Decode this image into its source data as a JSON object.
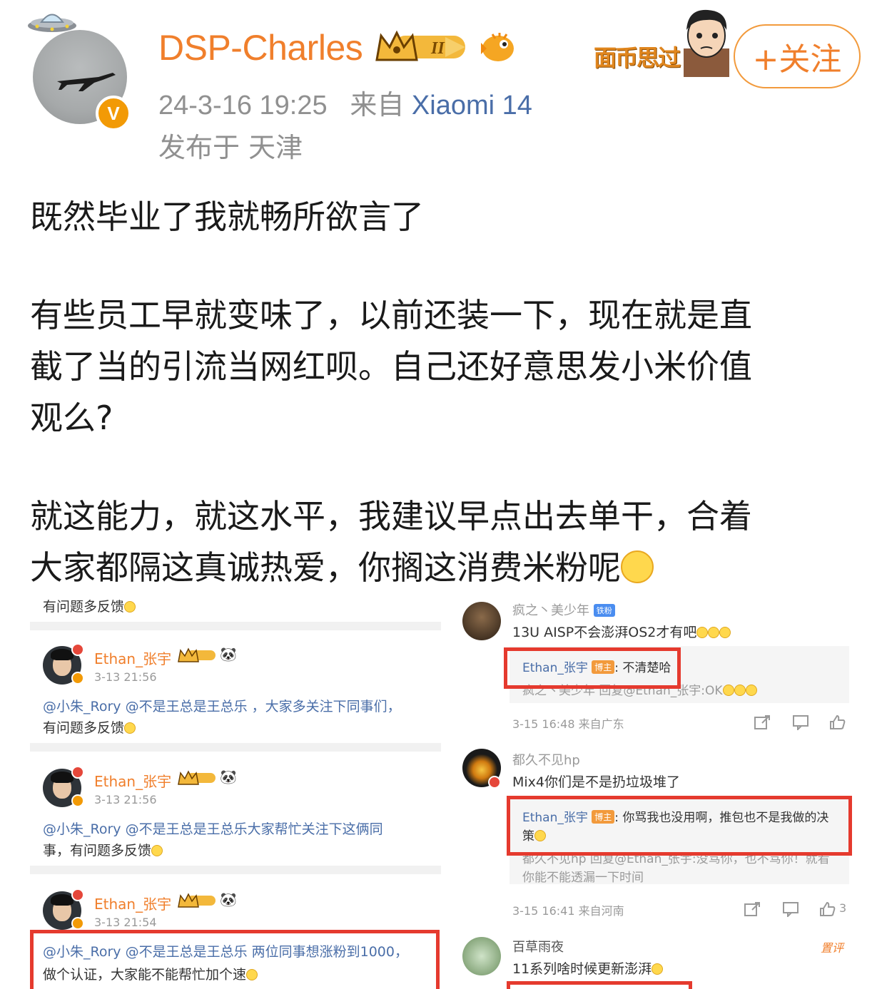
{
  "header": {
    "username": "DSP-Charles",
    "timestamp": "24-3-16 19:25",
    "source_prefix": "来自",
    "device": "Xiaomi 14",
    "location": "发布于 天津",
    "sticker_text": "面币思过",
    "follow_label": "+关注",
    "badge_letter": "V",
    "level_badge": "II"
  },
  "post": {
    "line1": "既然毕业了我就畅所欲言了",
    "line2a": "有些员工早就变味了，以前还装一下，现在就是直",
    "line2b": "截了当的引流当网红呗。自己还好意思发小米价值",
    "line2c": "观么?",
    "line3a": "就这能力，就这水平，我建议早点出去单干，合着",
    "line3b": "大家都隔这真诚热爱，你搁这消费米粉呢"
  },
  "left_comments": {
    "top_text": "有问题多反馈",
    "items": [
      {
        "name": "Ethan_张宇",
        "time": "3-13 21:56",
        "line1": "@小朱_Rory @不是王总是王总乐 ，大家多关注下同事们，",
        "line2": "有问题多反馈"
      },
      {
        "name": "Ethan_张宇",
        "time": "3-13 21:56",
        "line1": "@小朱_Rory @不是王总是王总乐大家帮忙关注下这俩同",
        "line2": "事，有问题多反馈"
      },
      {
        "name": "Ethan_张宇",
        "time": "3-13 21:54",
        "line1": "@小朱_Rory @不是王总是王总乐 两位同事想涨粉到1000，",
        "line2": "做个认证，大家能不能帮忙加个速"
      }
    ]
  },
  "right_comments": {
    "c1": {
      "name": "疯之丶美少年",
      "tag": "铁粉",
      "text": "13U  AISP不会澎湃OS2才有吧",
      "reply_name": "Ethan_张宇",
      "reply_tag": "博主",
      "reply_text": ": 不清楚哈",
      "reply2": "疯之丶美少年 回复@Ethan_张宇:OK",
      "meta": "3-15 16:48 来自广东"
    },
    "c2": {
      "name": "都久不见hp",
      "text": "Mix4你们是不是扔垃圾堆了",
      "reply_name": "Ethan_张宇",
      "reply_tag": "博主",
      "reply_text": ": 你骂我也没用啊，推包也不是我做的决",
      "reply_text2": "策",
      "reply2": "都久不见hp 回复@Ethan_张宇:没骂你，也不骂你！就看",
      "reply3": "你能不能透漏一下时间",
      "meta": "3-15 16:41 来自河南",
      "likes": "3"
    },
    "c3": {
      "name": "百草雨夜",
      "label": "置评",
      "text": "11系列啥时候更新澎湃"
    }
  },
  "colors": {
    "username": "#f07f2c",
    "device": "#4a6ea8",
    "highlight_box": "#e53a2e",
    "follow_border": "#f29a3c"
  }
}
